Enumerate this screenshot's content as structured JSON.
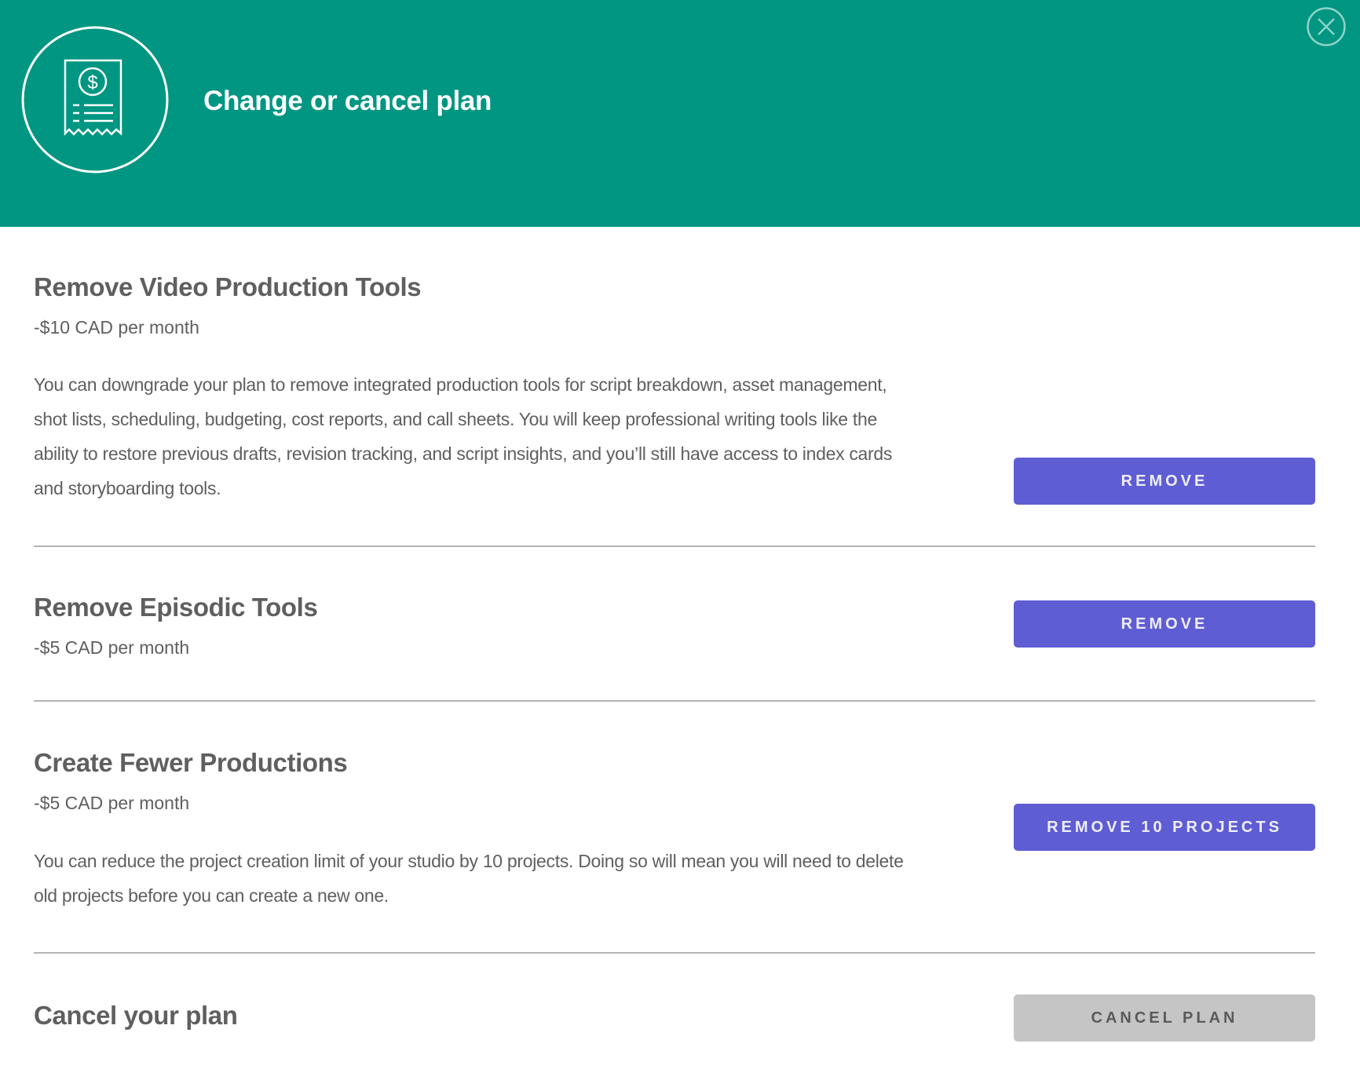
{
  "header": {
    "title": "Change or cancel plan",
    "icon": "receipt-dollar-icon",
    "close_icon": "close-icon",
    "background_color": "#009682"
  },
  "sections": [
    {
      "heading": "Remove Video Production Tools",
      "price": "-$10 CAD per month",
      "description": "You can downgrade your plan to remove integrated production tools for script breakdown, asset management, shot lists, scheduling, budgeting, cost reports, and call sheets. You will keep professional writing tools like the ability to restore previous drafts, revision tracking, and script insights, and you’ll still have access to index cards and storyboarding tools.",
      "button_label": "REMOVE"
    },
    {
      "heading": "Remove Episodic Tools",
      "price": "-$5 CAD per month",
      "button_label": "REMOVE"
    },
    {
      "heading": "Create Fewer Productions",
      "price": "-$5 CAD per month",
      "description": "You can reduce the project creation limit of your studio by 10 projects. Doing so will mean you will need to delete old projects before you can create a new one.",
      "button_label": "REMOVE 10 PROJECTS"
    },
    {
      "heading": "Cancel your plan",
      "button_label": "CANCEL PLAN"
    }
  ],
  "colors": {
    "primary_button": "#5f5dd3",
    "secondary_button": "#c5c5c5",
    "text": "#5f5f5f",
    "divider": "#b3b3b3"
  }
}
